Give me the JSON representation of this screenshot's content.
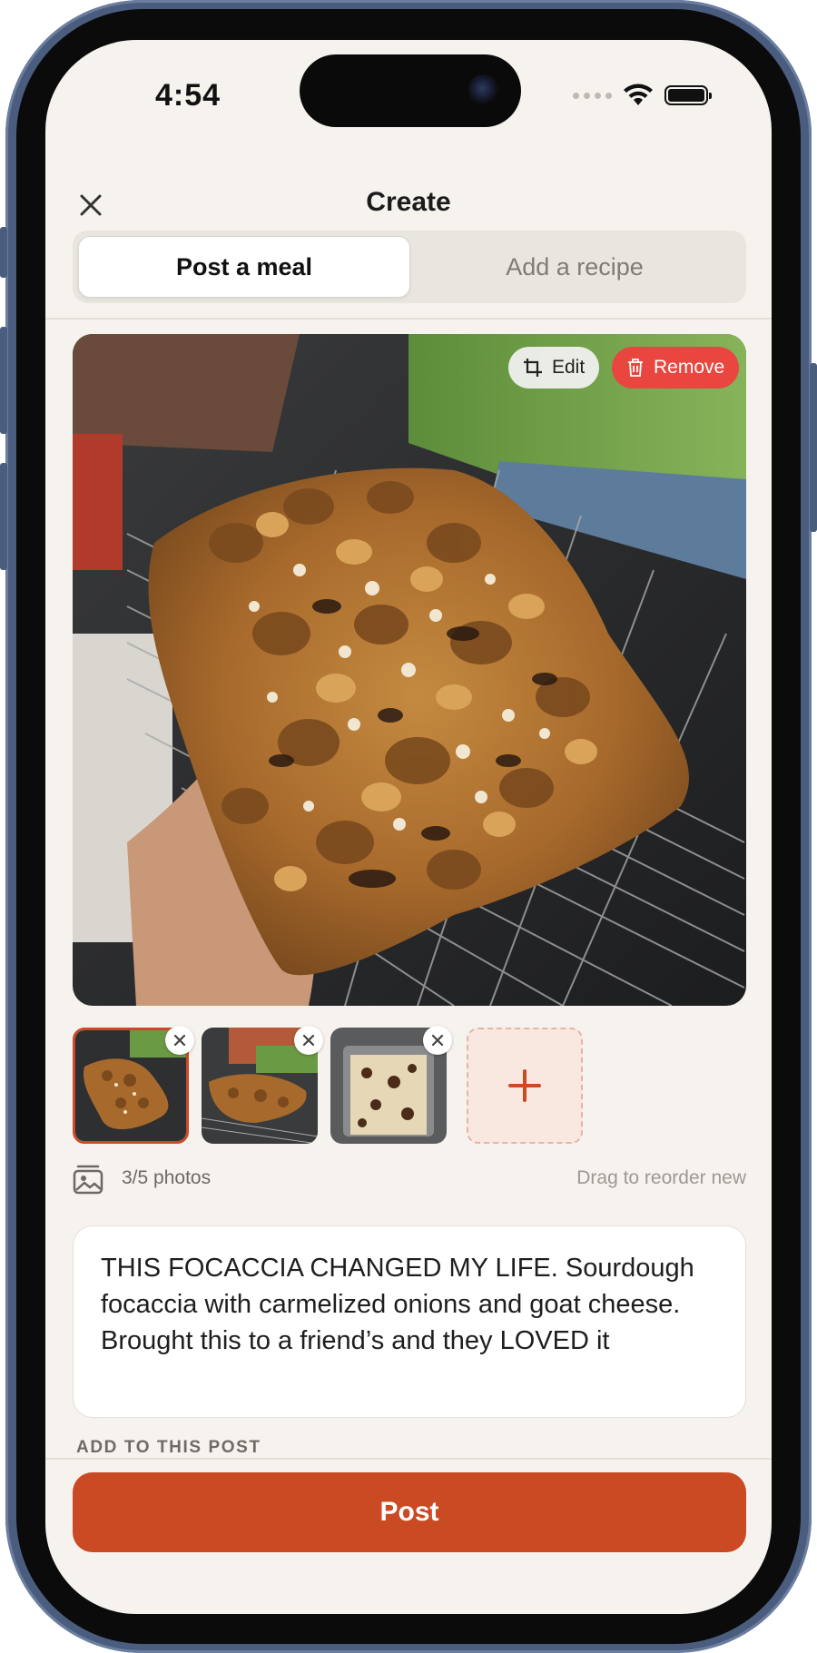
{
  "status_bar": {
    "time": "4:54"
  },
  "nav": {
    "title": "Create"
  },
  "tabs": [
    {
      "label": "Post a meal",
      "active": true
    },
    {
      "label": "Add a recipe",
      "active": false
    }
  ],
  "photo_actions": {
    "edit_label": "Edit",
    "remove_label": "Remove"
  },
  "gallery": {
    "photo_count": "3/5 photos",
    "reorder_hint": "Drag to reorder new",
    "thumbnails": [
      "focaccia-photo-1",
      "focaccia-photo-2",
      "focaccia-photo-3"
    ]
  },
  "caption": {
    "text": "THIS FOCACCIA CHANGED MY LIFE. Sourdough focaccia with carmelized onions and goat cheese. Brought this to a friend’s and they LOVED it"
  },
  "add_section": {
    "label": "ADD TO THIS POST"
  },
  "post_button": {
    "label": "Post"
  },
  "colors": {
    "accent": "#c94a23",
    "remove": "#e8463e",
    "background": "#f6f3ee"
  }
}
